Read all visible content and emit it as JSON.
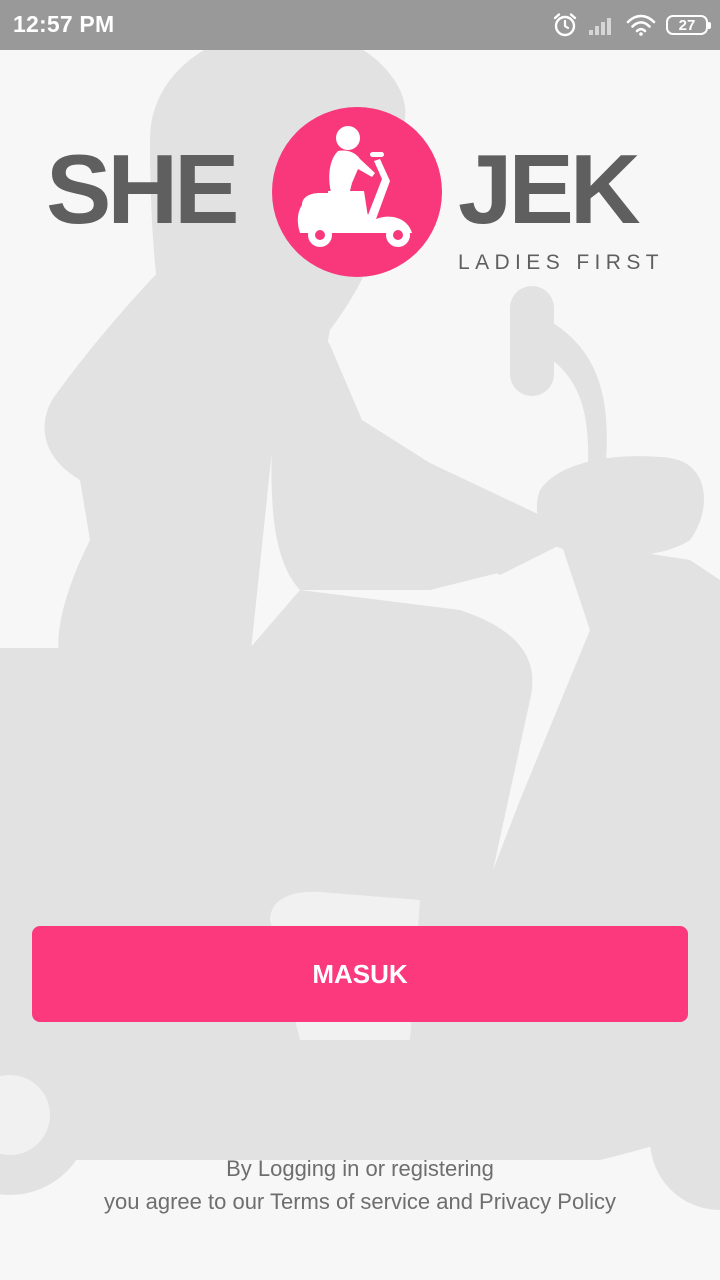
{
  "status_bar": {
    "time": "12:57 PM",
    "battery_level": "27",
    "icons": [
      "alarm-icon",
      "signal-icon",
      "wifi-icon",
      "battery-icon"
    ]
  },
  "logo": {
    "left_text": "SHE",
    "right_text": "JEK",
    "tagline": "LADIES FIRST",
    "emblem_icon": "woman-scooter-icon"
  },
  "login": {
    "button_label": "MASUK"
  },
  "terms": {
    "line1": "By Logging in or registering",
    "line2": "you agree to our Terms of service and Privacy Policy"
  },
  "colors": {
    "accent": "#fb397c",
    "logo_text": "#5f5f5f",
    "status_bar": "#999999",
    "background": "#f7f7f7",
    "silhouette": "#e2e2e2"
  }
}
